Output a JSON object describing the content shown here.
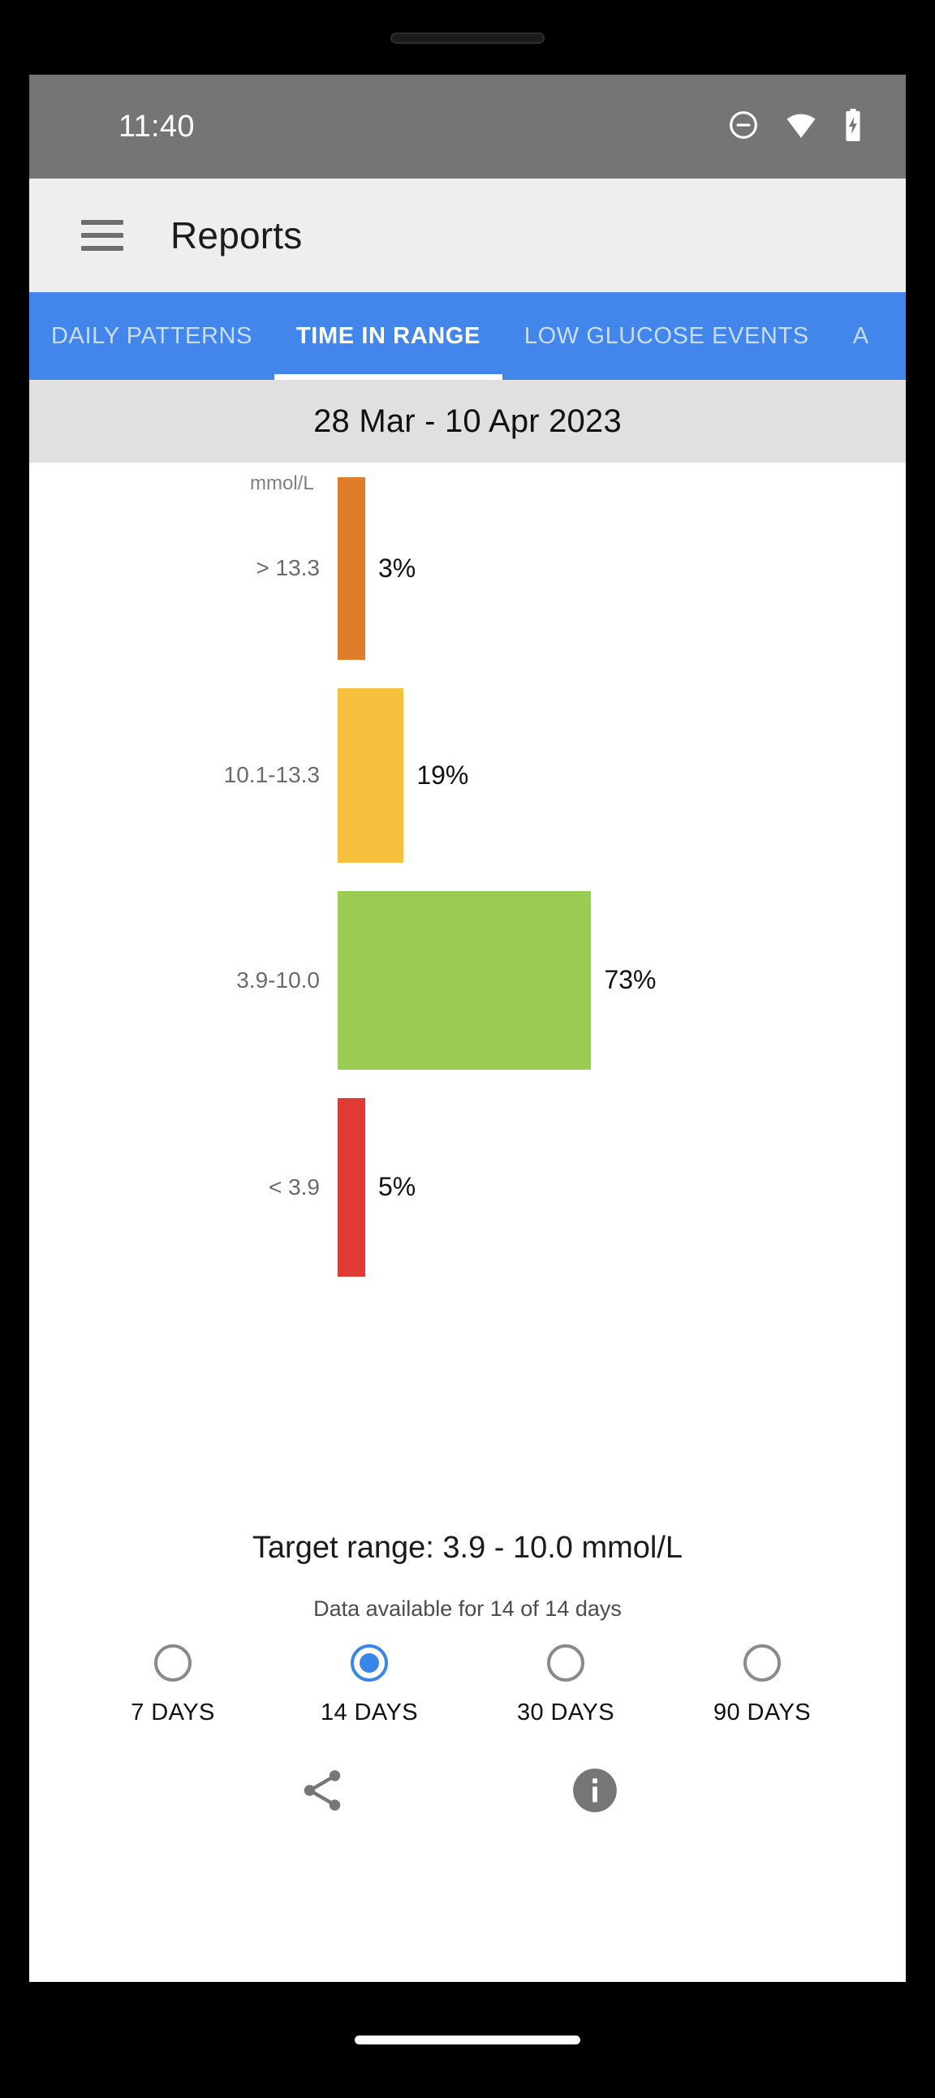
{
  "status_bar": {
    "time": "11:40",
    "icons": [
      "do-not-disturb-icon",
      "wifi-icon",
      "battery-charging-icon"
    ]
  },
  "app_bar": {
    "menu_icon": "hamburger-menu-icon",
    "title": "Reports"
  },
  "tabs": [
    {
      "label": "DAILY PATTERNS",
      "active": false
    },
    {
      "label": "TIME IN RANGE",
      "active": true
    },
    {
      "label": "LOW GLUCOSE EVENTS",
      "active": false
    },
    {
      "label": "A",
      "active": false
    }
  ],
  "date_header": {
    "range": "28 Mar - 10 Apr 2023"
  },
  "chart_data": {
    "type": "bar",
    "orientation": "horizontal",
    "title": "Time in Range",
    "unit_label": "mmol/L",
    "xlabel": "",
    "ylabel": "mmol/L",
    "categories": [
      "> 13.3",
      "10.1-13.3",
      "3.9-10.0",
      "< 3.9"
    ],
    "values": [
      3,
      19,
      73,
      5
    ],
    "value_labels": [
      "3%",
      "19%",
      "73%",
      "5%"
    ],
    "colors": [
      "#DF7C2B",
      "#F5C03E",
      "#9ACB52",
      "#DD3B33"
    ],
    "xlim": [
      0,
      100
    ],
    "grid": false,
    "legend": "none"
  },
  "footer": {
    "target_range": "Target range: 3.9 - 10.0 mmol/L",
    "data_available": "Data available for 14 of 14 days"
  },
  "day_range_options": [
    {
      "label": "7 DAYS",
      "selected": false
    },
    {
      "label": "14 DAYS",
      "selected": true
    },
    {
      "label": "30 DAYS",
      "selected": false
    },
    {
      "label": "90 DAYS",
      "selected": false
    }
  ],
  "actions": [
    {
      "name": "share-icon"
    },
    {
      "name": "info-icon"
    }
  ],
  "colors": {
    "tab_bar": "#4286ec",
    "accent": "#3a86e8",
    "status_bar": "#757575",
    "app_bar": "#eeeeee",
    "date_header": "#e0e0e0",
    "very_high": "#DF7C2B",
    "high": "#F5C03E",
    "in_range": "#9ACB52",
    "low": "#DD3B33"
  }
}
